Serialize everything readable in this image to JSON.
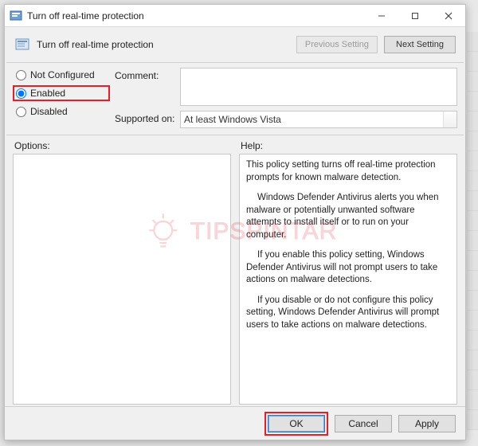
{
  "window": {
    "title": "Turn off real-time protection"
  },
  "header": {
    "policy_title": "Turn off real-time protection",
    "previous_setting": "Previous Setting",
    "next_setting": "Next Setting"
  },
  "state": {
    "not_configured": "Not Configured",
    "enabled": "Enabled",
    "disabled": "Disabled",
    "selected": "enabled"
  },
  "fields": {
    "comment_label": "Comment:",
    "comment_value": "",
    "supported_label": "Supported on:",
    "supported_value": "At least Windows Vista"
  },
  "panes": {
    "options_label": "Options:",
    "help_label": "Help:",
    "help_paragraphs": [
      "This policy setting turns off real-time protection prompts for known malware detection.",
      "Windows Defender Antivirus alerts you when malware or potentially unwanted software attempts to install itself or to run on your computer.",
      "If you enable this policy setting, Windows Defender Antivirus will not prompt users to take actions on malware detections.",
      "If you disable or do not configure this policy setting, Windows Defender Antivirus will prompt users to take actions on malware detections."
    ]
  },
  "footer": {
    "ok": "OK",
    "cancel": "Cancel",
    "apply": "Apply"
  },
  "watermark": "TIPSPINTAR"
}
